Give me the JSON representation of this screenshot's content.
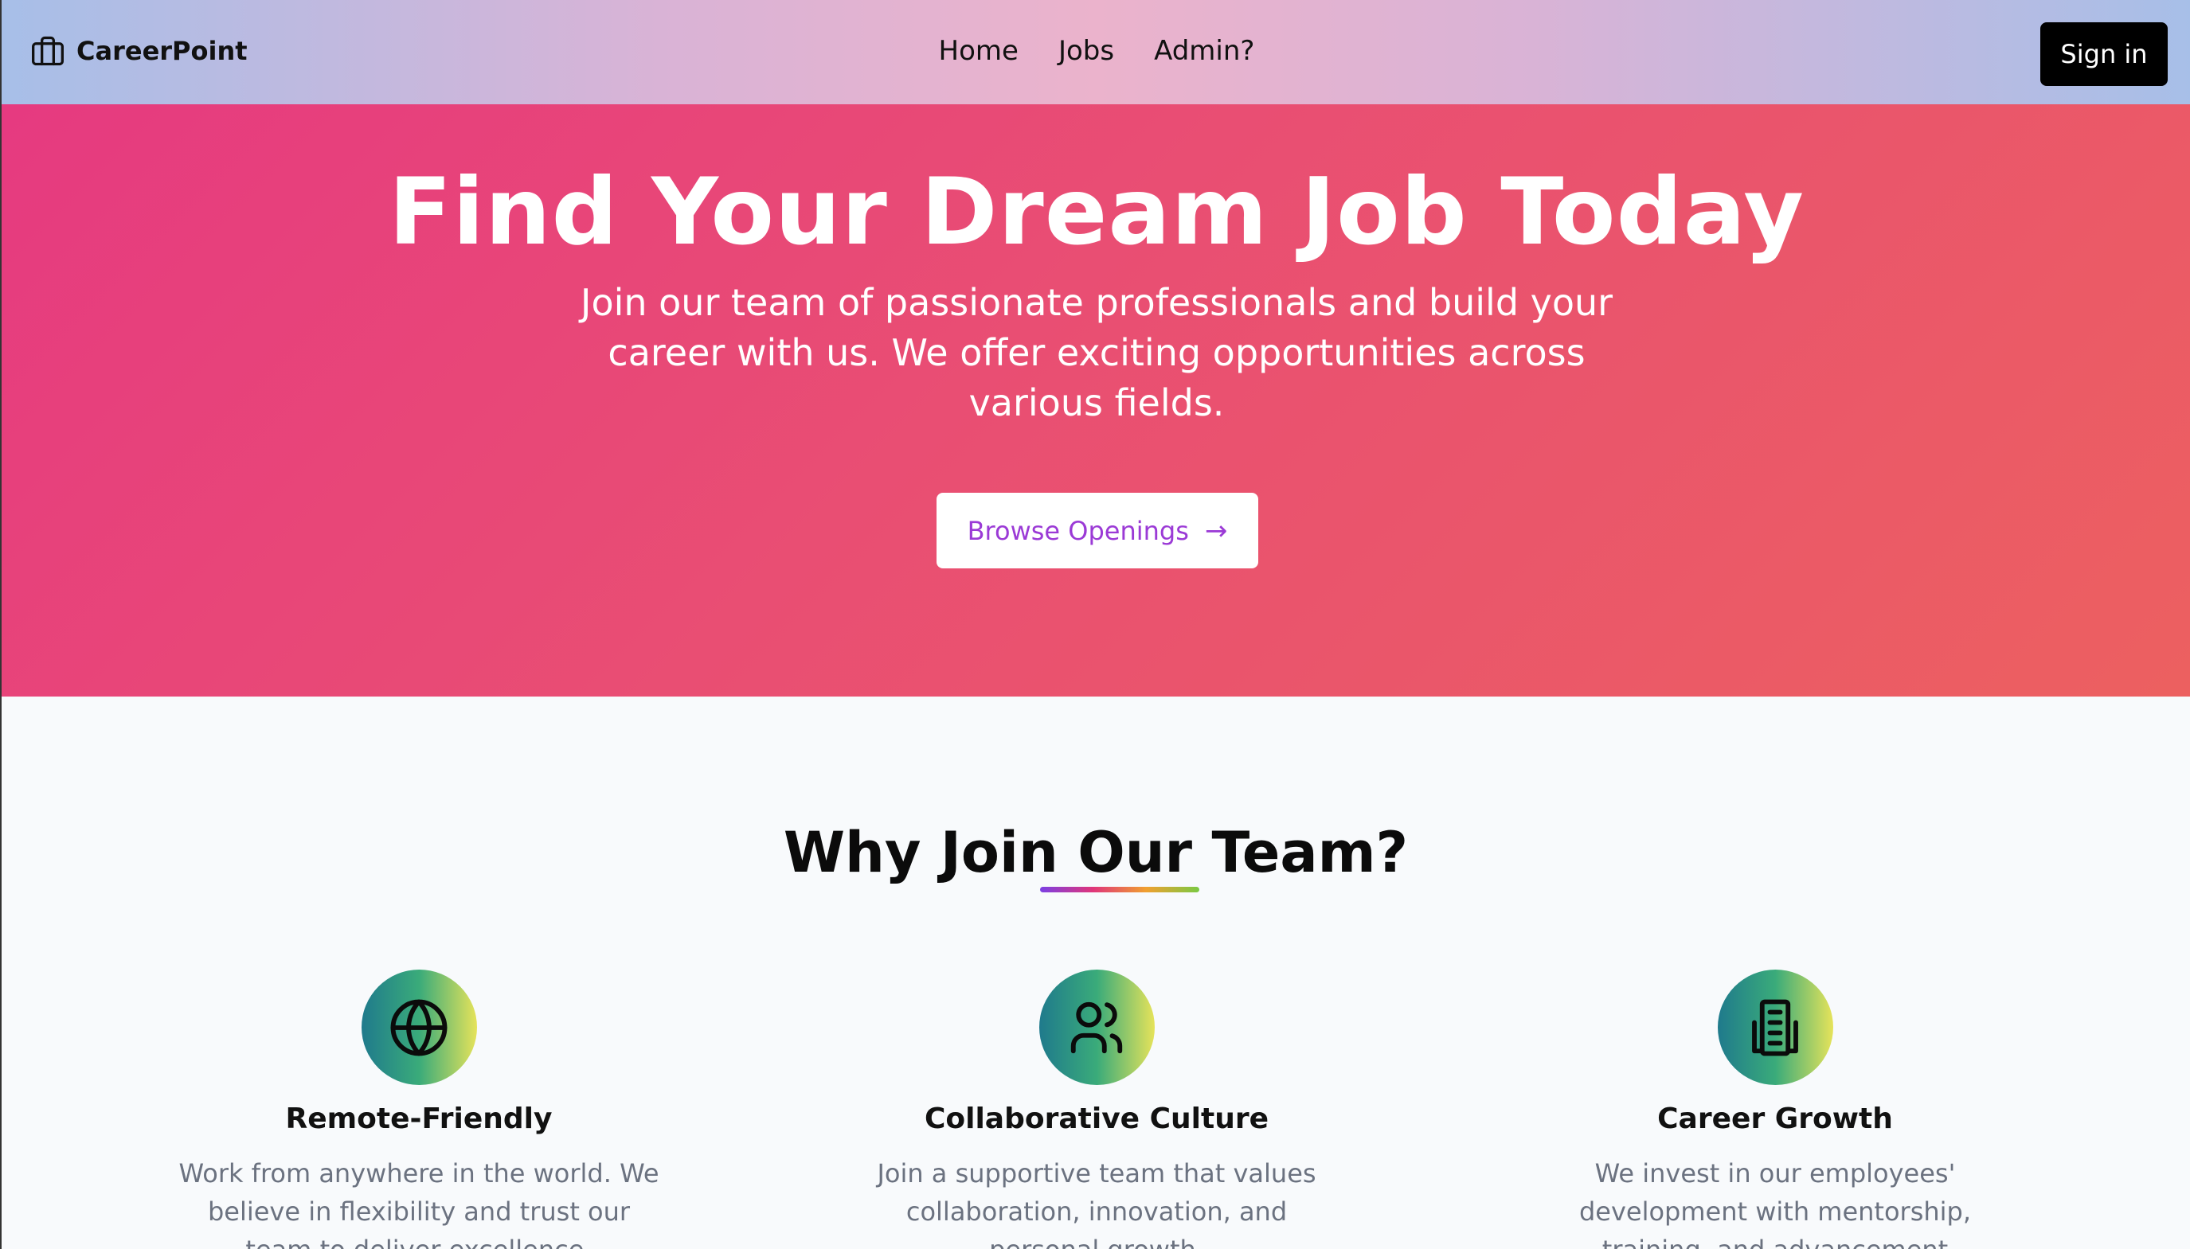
{
  "navbar": {
    "brand": "CareerPoint",
    "links": [
      "Home",
      "Jobs",
      "Admin?"
    ],
    "signin_label": "Sign in"
  },
  "hero": {
    "title": "Find Your Dream Job Today",
    "subtitle": "Join our team of passionate professionals and build your career with us. We offer exciting opportunities across various fields.",
    "cta_label": "Browse Openings"
  },
  "why": {
    "title": "Why Join Our Team?",
    "features": [
      {
        "icon": "globe-icon",
        "title": "Remote-Friendly",
        "text": "Work from anywhere in the world. We believe in flexibility and trust our team to deliver excellence."
      },
      {
        "icon": "users-icon",
        "title": "Collaborative Culture",
        "text": "Join a supportive team that values collaboration, innovation, and personal growth."
      },
      {
        "icon": "building-icon",
        "title": "Career Growth",
        "text": "We invest in our employees' development with mentorship, training, and advancement opportunities."
      }
    ]
  },
  "colors": {
    "hero_start": "#e63a80",
    "hero_end": "#ec6060",
    "cta_text": "#9b3ad6",
    "signin_bg": "#000000"
  }
}
